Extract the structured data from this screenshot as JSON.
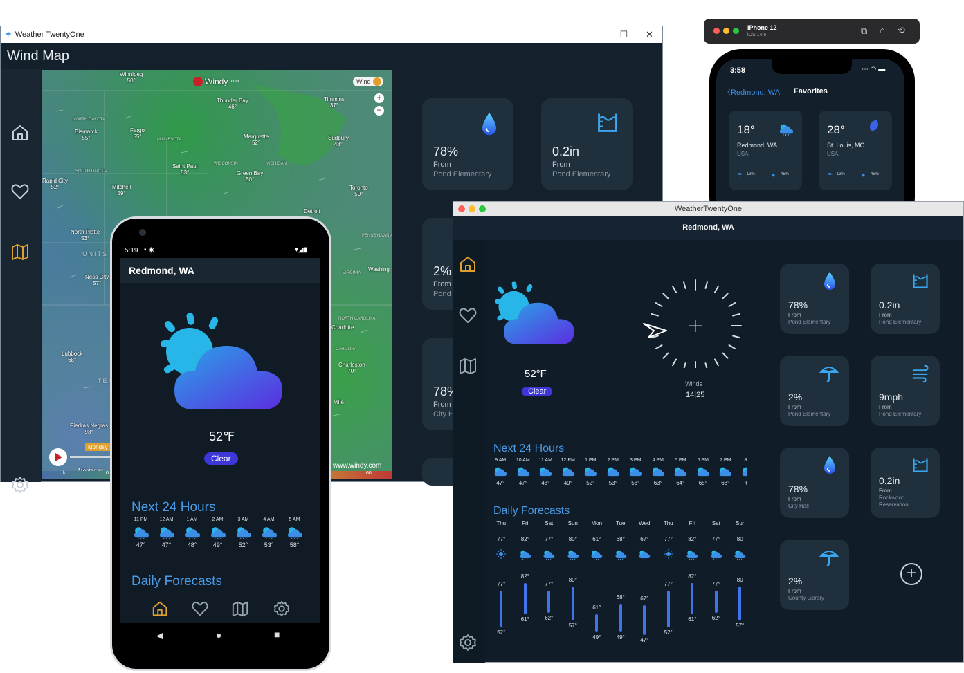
{
  "windows_app": {
    "window_title": "Weather TwentyOne",
    "controls": {
      "minimize": "—",
      "maximize": "☐",
      "close": "✕"
    },
    "page_title": "Wind Map",
    "nav": [
      "home-icon",
      "heart-icon",
      "map-icon",
      "gear-icon"
    ],
    "map": {
      "brand": "Windy",
      "brand_suffix": ".com",
      "layer_label": "Wind",
      "timeline_label": "Monday",
      "footer_url": "www.windy.com",
      "scale_left": "kt",
      "scale_mid": "0",
      "scale_right": "60",
      "labels": [
        {
          "name": "Winnipeg",
          "temp": "50°"
        },
        {
          "name": "Thunder Bay",
          "temp": "46°"
        },
        {
          "name": "Timmins",
          "temp": "37°"
        },
        {
          "name": "NORTH DAKOTA",
          "temp": ""
        },
        {
          "name": "Bismarck",
          "temp": "55°"
        },
        {
          "name": "Fargo",
          "temp": "55°"
        },
        {
          "name": "MINNESOTA",
          "temp": ""
        },
        {
          "name": "Marquette",
          "temp": "52°"
        },
        {
          "name": "Sudbury",
          "temp": "48°"
        },
        {
          "name": "Saint Paul",
          "temp": "53°"
        },
        {
          "name": "WISCONSIN",
          "temp": ""
        },
        {
          "name": "MICHIGAN",
          "temp": ""
        },
        {
          "name": "SOUTH DAKOTA",
          "temp": ""
        },
        {
          "name": "Green Bay",
          "temp": "50°"
        },
        {
          "name": "Rapid City",
          "temp": "52°"
        },
        {
          "name": "Mitchell",
          "temp": "59°"
        },
        {
          "name": "Toronto",
          "temp": "50°"
        },
        {
          "name": "Detroit",
          "temp": ""
        },
        {
          "name": "North Platte",
          "temp": "53°"
        },
        {
          "name": "PENNSYLVANIA",
          "temp": ""
        },
        {
          "name": "Ness City",
          "temp": "57°"
        },
        {
          "name": "Washing",
          "temp": ""
        },
        {
          "name": "VIRGINIA",
          "temp": ""
        },
        {
          "name": "NORTH CAROLINA",
          "temp": ""
        },
        {
          "name": "Lubbock",
          "temp": "68°"
        },
        {
          "name": "Charlotte",
          "temp": ""
        },
        {
          "name": "CAROLINA",
          "temp": ""
        },
        {
          "name": "Charleston",
          "temp": "70°"
        },
        {
          "name": "Piedras Negras",
          "temp": "98°"
        },
        {
          "name": "Monterrey",
          "temp": ""
        },
        {
          "name": "UNITS",
          "temp": ""
        },
        {
          "name": "TEXA",
          "temp": ""
        },
        {
          "name": "ville",
          "temp": ""
        }
      ]
    },
    "cards": [
      {
        "value": "78%",
        "from": "From",
        "source": "Pond Elementary",
        "icon": "drop-icon"
      },
      {
        "value": "0.2in",
        "from": "From",
        "source": "Pond Elementary",
        "icon": "rain-gauge-icon"
      },
      {
        "value": "2%",
        "from": "From",
        "source": "Pond",
        "icon": "umbrella-icon"
      },
      {
        "value": "78%",
        "from": "From",
        "source": "City H",
        "icon": "drop-icon"
      }
    ]
  },
  "ios_app": {
    "device": "iPhone 12",
    "os": "iOS 14.5",
    "time": "3:58",
    "back_label": "Redmond, WA",
    "title": "Favorites",
    "favorites": [
      {
        "temp": "18°",
        "city": "Redmond, WA",
        "country": "USA",
        "rain": "13%",
        "humidity": "45%"
      },
      {
        "temp": "28°",
        "city": "St. Louis, MO",
        "country": "USA",
        "rain": "13%",
        "humidity": "45%"
      }
    ]
  },
  "android_app": {
    "status_time": "5:19",
    "location": "Redmond, WA",
    "temperature": "52℉",
    "condition": "Clear",
    "next24_title": "Next 24 Hours",
    "hours": [
      {
        "time": "11 PM",
        "temp": "47°"
      },
      {
        "time": "12 AM",
        "temp": "47°"
      },
      {
        "time": "1 AM",
        "temp": "48°"
      },
      {
        "time": "2 AM",
        "temp": "49°"
      },
      {
        "time": "3 AM",
        "temp": "52°"
      },
      {
        "time": "4 AM",
        "temp": "53°"
      },
      {
        "time": "5 AM",
        "temp": "58°"
      }
    ],
    "daily_title": "Daily Forecasts",
    "nav": [
      "home-icon",
      "heart-icon",
      "map-icon",
      "gear-icon"
    ]
  },
  "mac_app": {
    "window_title": "WeatherTwentyOne",
    "location": "Redmond, WA",
    "temperature": "52°F",
    "condition": "Clear",
    "winds_label": "Winds",
    "winds_value": "14|25",
    "next24_title": "Next 24 Hours",
    "hours": [
      {
        "time": "9 AM",
        "temp": "47°"
      },
      {
        "time": "10 AM",
        "temp": "47°"
      },
      {
        "time": "11 AM",
        "temp": "48°"
      },
      {
        "time": "12 PM",
        "temp": "49°"
      },
      {
        "time": "1 PM",
        "temp": "52°"
      },
      {
        "time": "2 PM",
        "temp": "53°"
      },
      {
        "time": "3 PM",
        "temp": "58°"
      },
      {
        "time": "4 PM",
        "temp": "63°"
      },
      {
        "time": "5 PM",
        "temp": "64°"
      },
      {
        "time": "6 PM",
        "temp": "65°"
      },
      {
        "time": "7 PM",
        "temp": "68°"
      },
      {
        "time": "8 P",
        "temp": "6("
      }
    ],
    "daily_title": "Daily Forecasts",
    "days": [
      {
        "day": "Thu",
        "high": "77°",
        "low": "52°"
      },
      {
        "day": "Fri",
        "high": "82°",
        "low": "61°"
      },
      {
        "day": "Sat",
        "high": "77°",
        "low": "62°"
      },
      {
        "day": "Sun",
        "high": "80°",
        "low": "57°"
      },
      {
        "day": "Mon",
        "high": "61°",
        "low": "49°"
      },
      {
        "day": "Tue",
        "high": "68°",
        "low": "49°"
      },
      {
        "day": "Wed",
        "high": "67°",
        "low": "47°"
      },
      {
        "day": "Thu",
        "high": "77°",
        "low": "52°"
      },
      {
        "day": "Fri",
        "high": "82°",
        "low": "61°"
      },
      {
        "day": "Sat",
        "high": "77°",
        "low": "62°"
      },
      {
        "day": "Sur",
        "high": "80",
        "low": "57°"
      }
    ],
    "cards": [
      {
        "value": "78%",
        "from": "From",
        "source": "Pond Elementary",
        "icon": "drop-icon"
      },
      {
        "value": "0.2in",
        "from": "From",
        "source": "Pond Elementary",
        "icon": "rain-gauge-icon"
      },
      {
        "value": "2%",
        "from": "From",
        "source": "Pond Elementary",
        "icon": "umbrella-icon"
      },
      {
        "value": "9mph",
        "from": "From",
        "source": "Pond Elementary",
        "icon": "wind-icon"
      },
      {
        "value": "78%",
        "from": "From",
        "source": "City Hall",
        "icon": "drop-icon"
      },
      {
        "value": "0.2in",
        "from": "From",
        "source": "Rockwood Reservation",
        "icon": "rain-gauge-icon"
      },
      {
        "value": "2%",
        "from": "From",
        "source": "County Library",
        "icon": "umbrella-icon"
      }
    ],
    "add_button": "add-circle-icon"
  },
  "colors": {
    "bg_dark": "#101d28",
    "card": "#1f2f3c",
    "accent_blue": "#4a9be8",
    "accent_gold": "#e0a030",
    "clear_pill": "#3d37d8"
  }
}
